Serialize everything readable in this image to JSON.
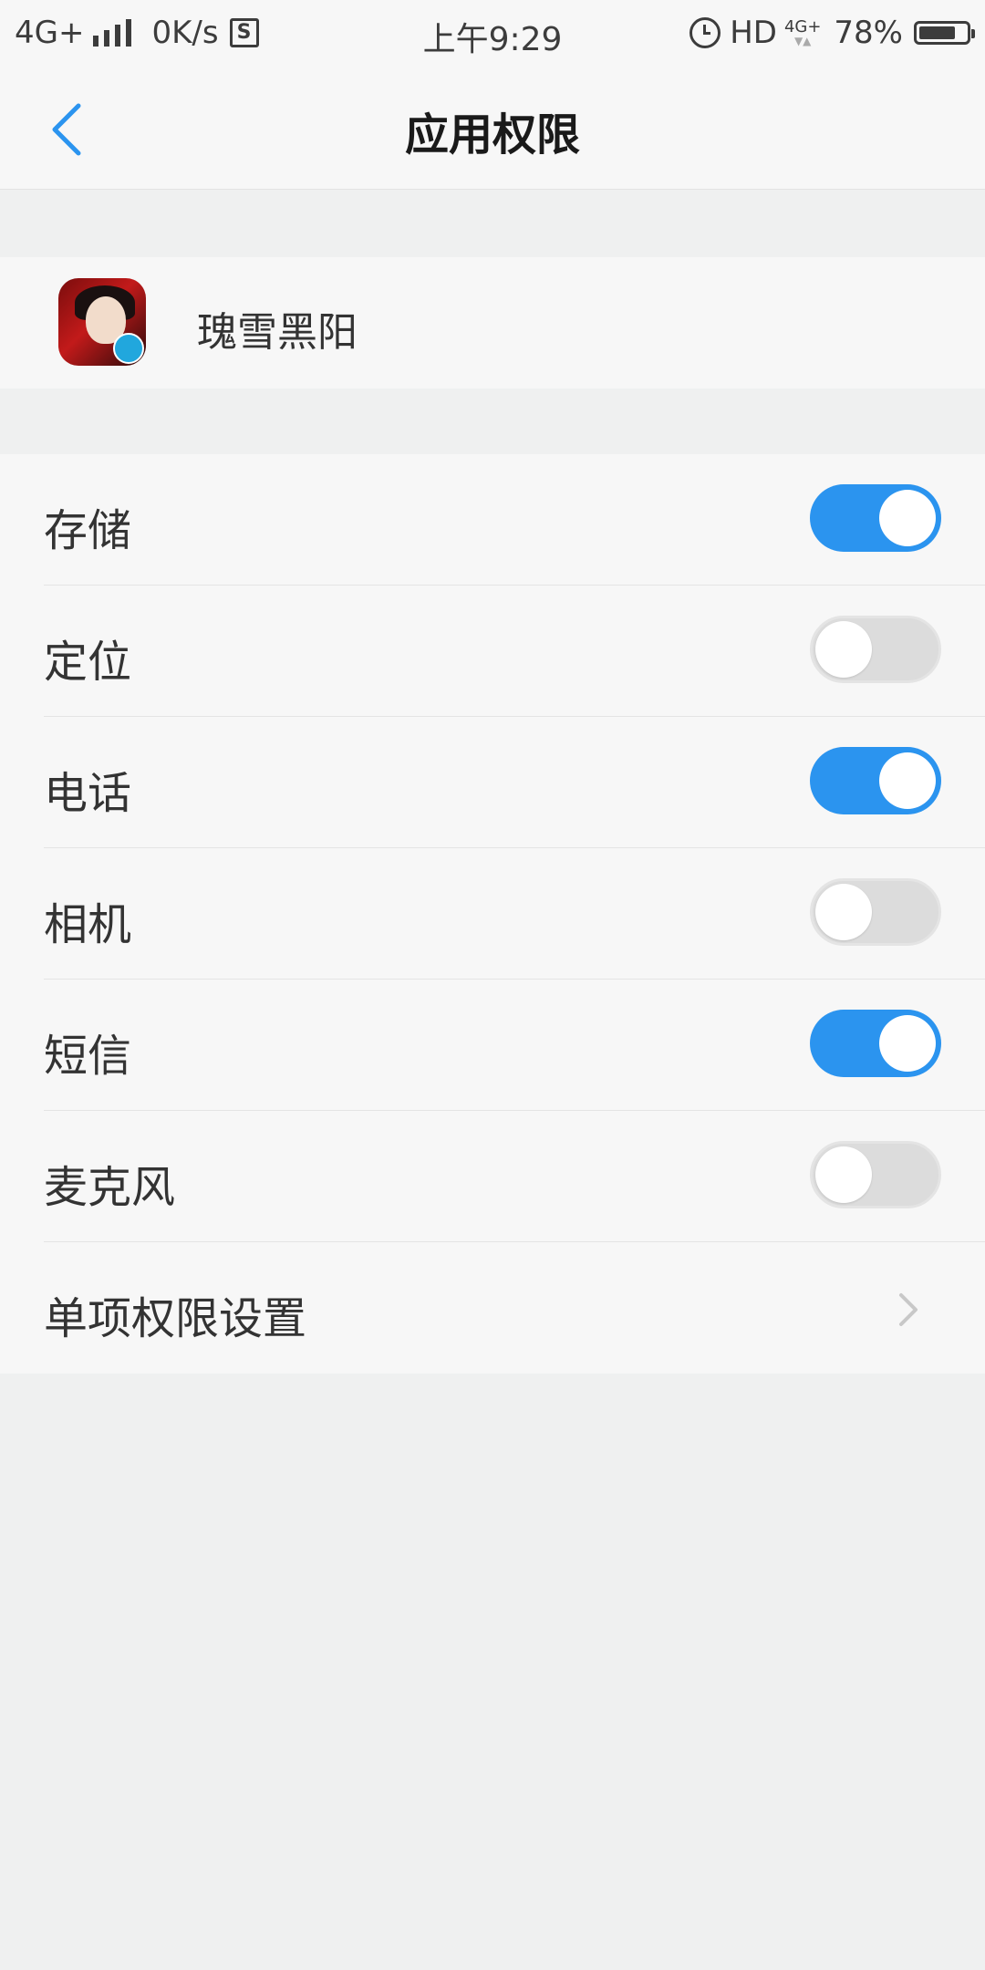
{
  "status_bar": {
    "network": "4G+",
    "speed": "0K/s",
    "s_icon": "S",
    "time": "上午9:29",
    "hd": "HD",
    "net_small": "4G+",
    "net_arrows": "▼▲",
    "battery_percent": "78%",
    "battery_level": 0.78
  },
  "header": {
    "title": "应用权限",
    "back_icon": "chevron-left-icon"
  },
  "app": {
    "name": "瑰雪黑阳"
  },
  "permissions": [
    {
      "label": "存储",
      "enabled": true
    },
    {
      "label": "定位",
      "enabled": false
    },
    {
      "label": "电话",
      "enabled": true
    },
    {
      "label": "相机",
      "enabled": false
    },
    {
      "label": "短信",
      "enabled": true
    },
    {
      "label": "麦克风",
      "enabled": false
    }
  ],
  "single_permission": {
    "label": "单项权限设置",
    "icon": "chevron-right-icon"
  },
  "colors": {
    "accent": "#2b94ef",
    "toggle_off": "#dcdcdc",
    "background": "#eff0f0",
    "panel": "#f7f7f7"
  }
}
